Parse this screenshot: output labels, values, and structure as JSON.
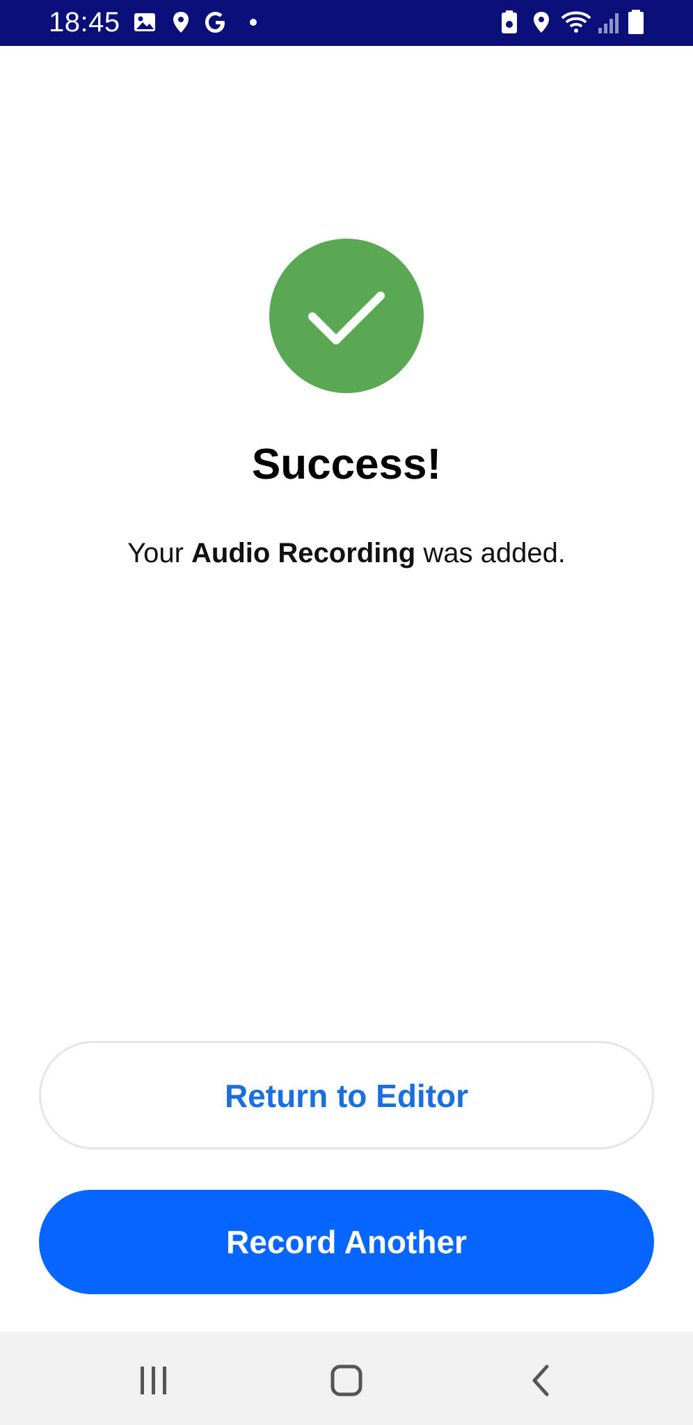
{
  "status_bar": {
    "time": "18:45",
    "left_icons": [
      "image-icon",
      "location-icon",
      "google-icon",
      "dot-icon"
    ],
    "right_icons": [
      "battery-saver-icon",
      "location-icon",
      "wifi-icon",
      "signal-icon",
      "battery-icon"
    ]
  },
  "content": {
    "title": "Success!",
    "message_prefix": "Your ",
    "message_bold": "Audio Recording",
    "message_suffix": " was added."
  },
  "actions": {
    "return_label": "Return to Editor",
    "record_label": "Record Another"
  },
  "nav_bar": {
    "icons": [
      "recent-apps-icon",
      "home-icon",
      "back-icon"
    ]
  },
  "colors": {
    "status_bar": "#0a0f7a",
    "success_green": "#5ba854",
    "primary_blue": "#0766ff",
    "link_blue": "#1a6fe0",
    "nav_bar": "#f1f1f1"
  }
}
